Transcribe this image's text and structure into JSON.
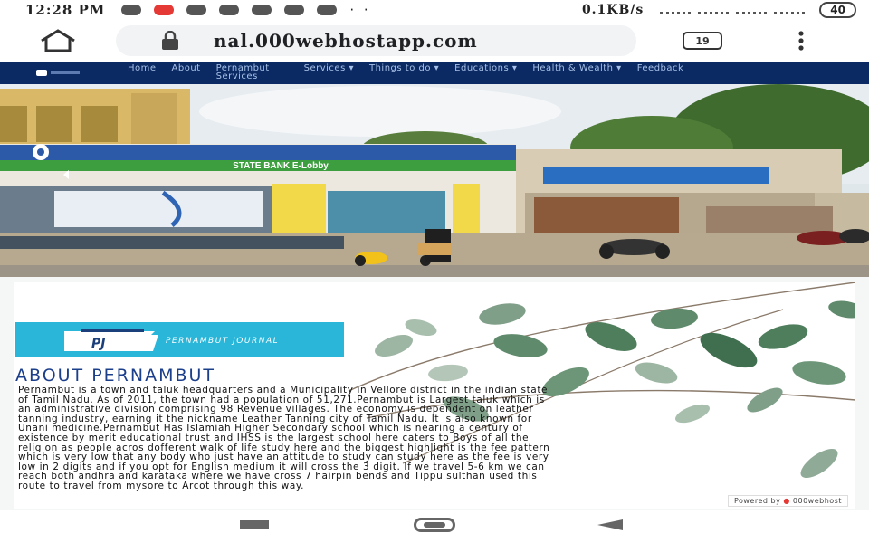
{
  "status_bar": {
    "time": "12:28 PM",
    "dots": "· ·",
    "network_speed": "0.1KB/s",
    "battery": "40",
    "tabs_count": "19"
  },
  "browser": {
    "url": "nal.000webhostapp.com"
  },
  "site_nav": {
    "items": [
      {
        "label": "Home"
      },
      {
        "label": "About"
      },
      {
        "label": "Pernambut Services"
      },
      {
        "label": "Services ▾"
      },
      {
        "label": "Things to do ▾"
      },
      {
        "label": "Educations ▾"
      },
      {
        "label": "Health & Wealth ▾"
      },
      {
        "label": "Feedback"
      }
    ]
  },
  "hero": {
    "sign_main": "STATE BANK E-Lobby"
  },
  "content": {
    "journal_label": "PERNAMBUT JOURNAL",
    "logo_text": "PJ",
    "about_title": "ABOUT PERNAMBUT",
    "about_text": "Pernambut is a town and taluk headquarters and a Municipality in Vellore district in the indian state of Tamil Nadu. As of 2011, the town had a population of 51,271.Pernambut is Largest taluk which is an administrative division comprising 98 Revenue villages. The economy is dependent on leather tanning industry, earning it the nickname Leather Tanning city of Tamil Nadu. It is also known for Unani medicine.Pernambut Has Islamiah Higher Secondary school which is nearing a century of existence by merit educational trust and IHSS is the largest school here caters to Boys of all the religion as people acros dofferent walk of life study here and the biggest highlight is the fee pattern which is very low that any body who just have an attitude to study can study here as the fee is very low in 2 digits and if you opt for English medium it will cross the 3 digit. If we travel 5-6 km we can reach both andhra and karataka where we have cross 7 hairpin bends and Tippu sulthan used this route to travel from mysore to Arcot through this way.",
    "powered_by": "Powered by",
    "powered_brand": "000webhost"
  }
}
